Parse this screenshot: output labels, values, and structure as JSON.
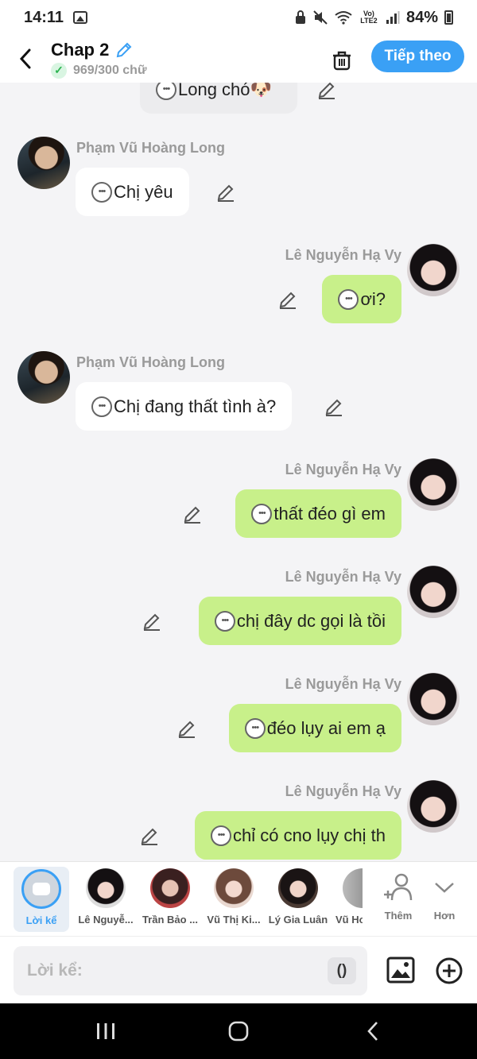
{
  "status_bar": {
    "time": "14:11",
    "network": "Vo) LTE2",
    "battery": "84%"
  },
  "header": {
    "title": "Chap 2",
    "word_count": "969/300 chữ",
    "next_label": "Tiếp theo"
  },
  "messages": [
    {
      "kind": "system",
      "text": "Long chó🐶"
    },
    {
      "kind": "in",
      "sender": "Phạm Vũ Hoàng Long",
      "text": "Chị yêu"
    },
    {
      "kind": "out",
      "sender": "Lê Nguyễn Hạ Vy",
      "text": "ơi?"
    },
    {
      "kind": "in",
      "sender": "Phạm Vũ Hoàng Long",
      "text": "Chị đang thất tình à?"
    },
    {
      "kind": "out",
      "sender": "Lê Nguyễn Hạ Vy",
      "text": "thất đéo gì em"
    },
    {
      "kind": "out",
      "sender": "Lê Nguyễn Hạ Vy",
      "text": "chị đây dc gọi là tồi"
    },
    {
      "kind": "out",
      "sender": "Lê Nguyễn Hạ Vy",
      "text": "đéo lụy ai em ạ"
    },
    {
      "kind": "out",
      "sender": "Lê Nguyễn Hạ Vy",
      "text": "chỉ có cno lụy chị th"
    }
  ],
  "characters": [
    {
      "label": "Lời kể",
      "selected": true
    },
    {
      "label": "Lê Nguyễ..."
    },
    {
      "label": "Trần Bảo ..."
    },
    {
      "label": "Vũ Thị Ki..."
    },
    {
      "label": "Lý Gia Luân"
    },
    {
      "label": "Vũ Ho"
    }
  ],
  "actions": {
    "add_label": "Thêm",
    "more_label": "Hơn"
  },
  "input": {
    "placeholder": "Lời kể:",
    "paren_label": "()"
  },
  "colors": {
    "accent": "#3aa0f5",
    "outgoing_bubble": "#c8f08a",
    "incoming_bubble": "#ffffff"
  }
}
